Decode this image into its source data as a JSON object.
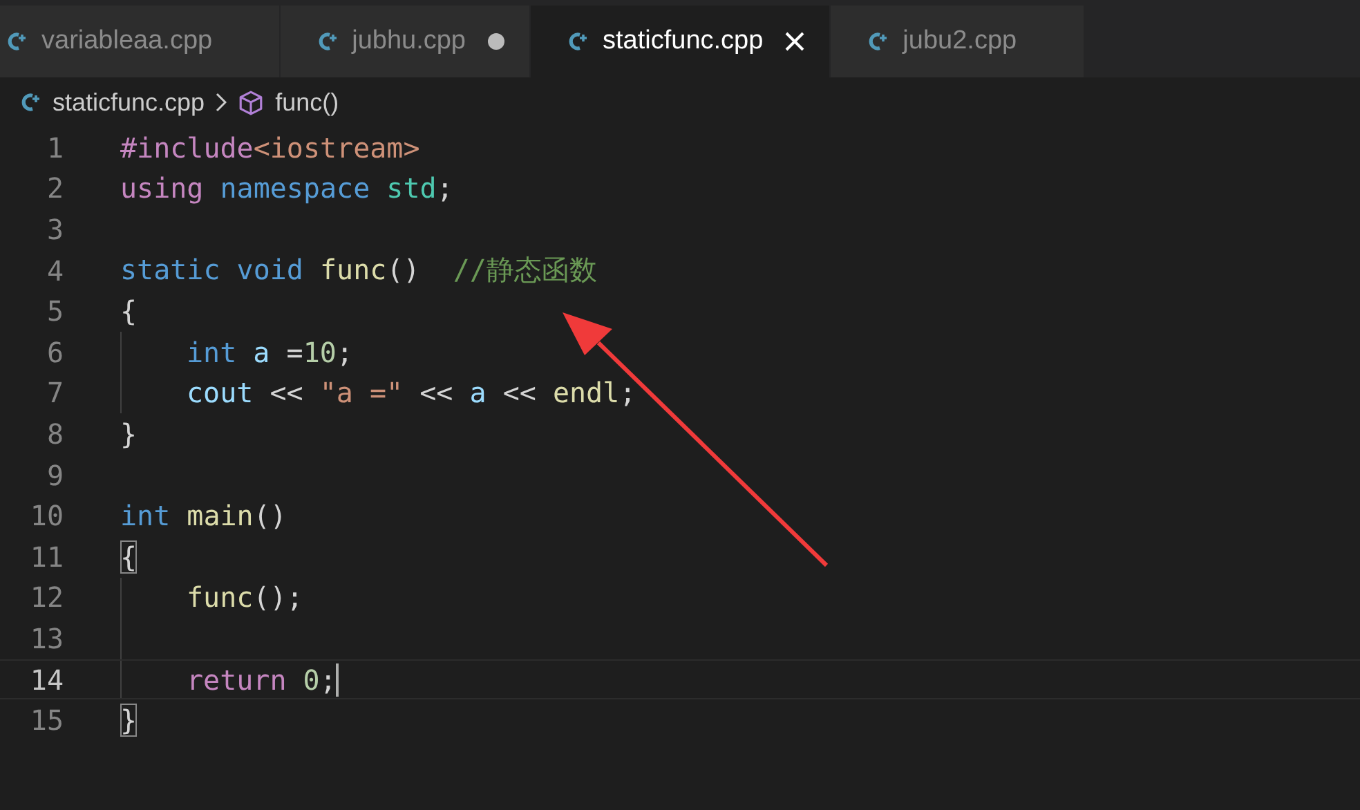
{
  "tabs": [
    {
      "label": "variableaa.cpp",
      "selected": false,
      "modified": false
    },
    {
      "label": "jubhu.cpp",
      "selected": false,
      "modified": true
    },
    {
      "label": "staticfunc.cpp",
      "selected": true,
      "modified": false
    },
    {
      "label": "jubu2.cpp",
      "selected": false,
      "modified": false
    }
  ],
  "breadcrumb": {
    "file": "staticfunc.cpp",
    "symbol": "func()"
  },
  "lines": [
    {
      "number": "1",
      "current": false,
      "indented": false,
      "tokens": [
        {
          "t": "#include",
          "color": "#c586c0"
        },
        {
          "t": "<iostream>",
          "color": "#ce9178"
        }
      ]
    },
    {
      "number": "2",
      "current": false,
      "indented": false,
      "tokens": [
        {
          "t": "using",
          "color": "#c586c0"
        },
        {
          "t": " namespace",
          "color": "#569cd6"
        },
        {
          "t": " std",
          "color": "#4ec9b0"
        },
        {
          "t": ";",
          "color": "#d4d4d4"
        }
      ]
    },
    {
      "number": "3",
      "current": false,
      "indented": false
    },
    {
      "number": "4",
      "current": false,
      "indented": false,
      "tokens": [
        {
          "t": "static",
          "color": "#569cd6"
        },
        {
          "t": " void",
          "color": "#569cd6"
        },
        {
          "t": " func",
          "color": "#dcdcaa"
        },
        {
          "t": "()  ",
          "color": "#d4d4d4"
        },
        {
          "t": "//静态函数",
          "color": "#6a9955"
        }
      ]
    },
    {
      "number": "5",
      "current": false,
      "indented": false,
      "tokens": [
        {
          "t": "{",
          "color": "#d4d4d4"
        }
      ]
    },
    {
      "number": "6",
      "current": false,
      "indented": true,
      "tokens": [
        {
          "t": "int",
          "color": "#569cd6"
        },
        {
          "t": " a",
          "color": "#9cdcfe"
        },
        {
          "t": " =",
          "color": "#d4d4d4"
        },
        {
          "t": "10",
          "color": "#b5cea8"
        },
        {
          "t": ";",
          "color": "#d4d4d4"
        }
      ]
    },
    {
      "number": "7",
      "current": false,
      "indented": true,
      "tokens": [
        {
          "t": "cout",
          "color": "#9cdcfe"
        },
        {
          "t": " << ",
          "color": "#d4d4d4"
        },
        {
          "t": "\"a =\"",
          "color": "#ce9178"
        },
        {
          "t": " << ",
          "color": "#d4d4d4"
        },
        {
          "t": "a",
          "color": "#9cdcfe"
        },
        {
          "t": " << ",
          "color": "#d4d4d4"
        },
        {
          "t": "endl",
          "color": "#dcdcaa"
        },
        {
          "t": ";",
          "color": "#d4d4d4"
        }
      ]
    },
    {
      "number": "8",
      "current": false,
      "indented": false,
      "tokens": [
        {
          "t": "}",
          "color": "#d4d4d4"
        }
      ]
    },
    {
      "number": "9",
      "current": false,
      "indented": false
    },
    {
      "number": "10",
      "current": false,
      "indented": false,
      "tokens": [
        {
          "t": "int",
          "color": "#569cd6"
        },
        {
          "t": " main",
          "color": "#dcdcaa"
        },
        {
          "t": "()",
          "color": "#d4d4d4"
        }
      ]
    },
    {
      "number": "11",
      "current": false,
      "indented": false,
      "tokens": [
        {
          "t": "{",
          "color": "#d4d4d4",
          "matched": true
        }
      ]
    },
    {
      "number": "12",
      "current": false,
      "indented": true,
      "tokens": [
        {
          "t": "func",
          "color": "#dcdcaa"
        },
        {
          "t": "();",
          "color": "#d4d4d4"
        }
      ]
    },
    {
      "number": "13",
      "current": false,
      "indented": true
    },
    {
      "number": "14",
      "current": true,
      "indented": true,
      "tokens": [
        {
          "t": "return",
          "color": "#c586c0"
        },
        {
          "t": " 0",
          "color": "#b5cea8"
        },
        {
          "t": ";",
          "color": "#d4d4d4"
        }
      ]
    },
    {
      "number": "15",
      "current": false,
      "indented": false,
      "tokens": [
        {
          "t": "}",
          "color": "#d4d4d4",
          "matched": true
        }
      ]
    }
  ]
}
